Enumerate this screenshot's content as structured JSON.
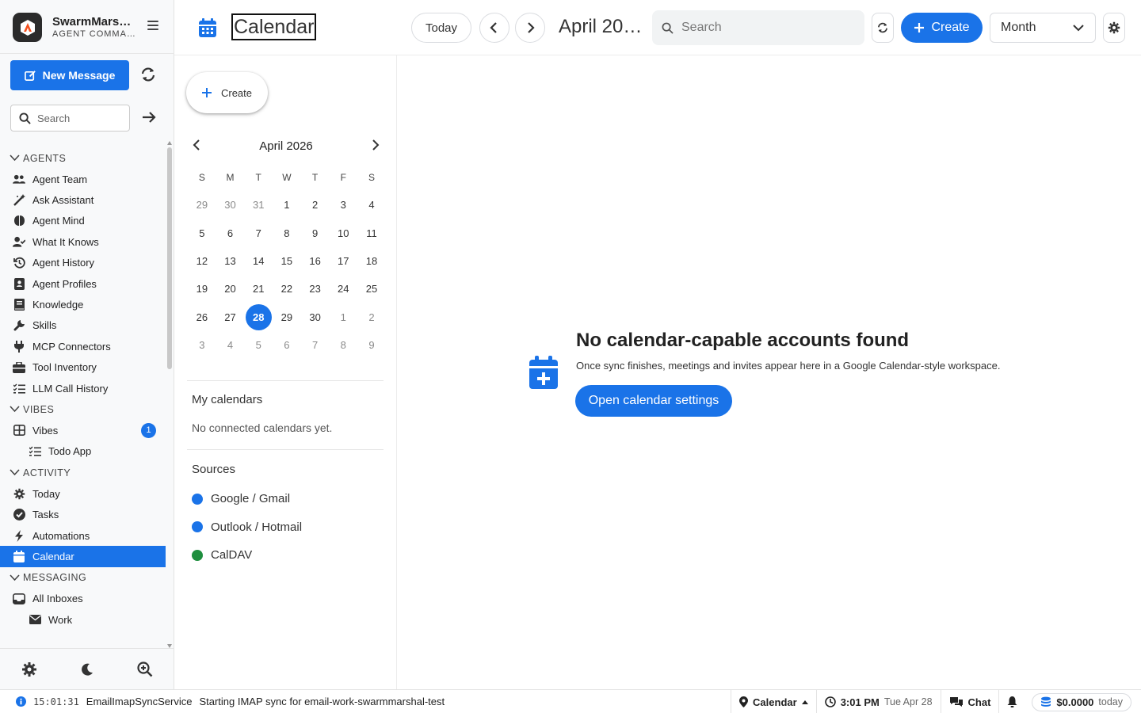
{
  "app": {
    "name": "SwarmMars…",
    "subtitle": "AGENT COMMA…"
  },
  "sidebar": {
    "new_message": "New Message",
    "search_placeholder": "Search",
    "sections": [
      {
        "label": "AGENTS",
        "items": [
          {
            "label": "Agent Team",
            "icon": "users-icon"
          },
          {
            "label": "Ask Assistant",
            "icon": "wand-icon"
          },
          {
            "label": "Agent Mind",
            "icon": "brain-icon"
          },
          {
            "label": "What It Knows",
            "icon": "user-check-icon"
          },
          {
            "label": "Agent History",
            "icon": "history-icon"
          },
          {
            "label": "Agent Profiles",
            "icon": "id-card-icon"
          },
          {
            "label": "Knowledge",
            "icon": "book-icon"
          },
          {
            "label": "Skills",
            "icon": "wrench-icon"
          },
          {
            "label": "MCP Connectors",
            "icon": "plug-icon"
          },
          {
            "label": "Tool Inventory",
            "icon": "toolbox-icon"
          },
          {
            "label": "LLM Call History",
            "icon": "list-check-icon"
          }
        ]
      },
      {
        "label": "VIBES",
        "items": [
          {
            "label": "Vibes",
            "icon": "grid-icon",
            "badge": "1"
          },
          {
            "label": "Todo App",
            "icon": "list-check-icon",
            "sub": true
          }
        ]
      },
      {
        "label": "ACTIVITY",
        "items": [
          {
            "label": "Today",
            "icon": "sun-gear-icon"
          },
          {
            "label": "Tasks",
            "icon": "check-circle-icon"
          },
          {
            "label": "Automations",
            "icon": "bolt-icon"
          },
          {
            "label": "Calendar",
            "icon": "calendar-icon",
            "active": true
          }
        ]
      },
      {
        "label": "MESSAGING",
        "items": [
          {
            "label": "All Inboxes",
            "icon": "inbox-icon"
          },
          {
            "label": "Work",
            "icon": "envelope-icon",
            "sub": true
          }
        ]
      }
    ]
  },
  "topbar": {
    "title": "Calendar",
    "today": "Today",
    "date_label": "April 20…",
    "search_placeholder": "Search",
    "create": "Create",
    "view": "Month"
  },
  "mini_calendar": {
    "create": "Create",
    "month_label": "April 2026",
    "weekdays": [
      "S",
      "M",
      "T",
      "W",
      "T",
      "F",
      "S"
    ],
    "weeks": [
      [
        {
          "d": "29",
          "dim": true
        },
        {
          "d": "30",
          "dim": true
        },
        {
          "d": "31",
          "dim": true
        },
        {
          "d": "1"
        },
        {
          "d": "2"
        },
        {
          "d": "3"
        },
        {
          "d": "4"
        }
      ],
      [
        {
          "d": "5"
        },
        {
          "d": "6"
        },
        {
          "d": "7"
        },
        {
          "d": "8"
        },
        {
          "d": "9"
        },
        {
          "d": "10"
        },
        {
          "d": "11"
        }
      ],
      [
        {
          "d": "12"
        },
        {
          "d": "13"
        },
        {
          "d": "14"
        },
        {
          "d": "15"
        },
        {
          "d": "16"
        },
        {
          "d": "17"
        },
        {
          "d": "18"
        }
      ],
      [
        {
          "d": "19"
        },
        {
          "d": "20"
        },
        {
          "d": "21"
        },
        {
          "d": "22"
        },
        {
          "d": "23"
        },
        {
          "d": "24"
        },
        {
          "d": "25"
        }
      ],
      [
        {
          "d": "26"
        },
        {
          "d": "27"
        },
        {
          "d": "28",
          "selected": true
        },
        {
          "d": "29"
        },
        {
          "d": "30"
        },
        {
          "d": "1",
          "dim": true
        },
        {
          "d": "2",
          "dim": true
        }
      ],
      [
        {
          "d": "3",
          "dim": true
        },
        {
          "d": "4",
          "dim": true
        },
        {
          "d": "5",
          "dim": true
        },
        {
          "d": "6",
          "dim": true
        },
        {
          "d": "7",
          "dim": true
        },
        {
          "d": "8",
          "dim": true
        },
        {
          "d": "9",
          "dim": true
        }
      ]
    ],
    "my_calendars_title": "My calendars",
    "my_calendars_empty": "No connected calendars yet.",
    "sources_title": "Sources",
    "sources": [
      {
        "label": "Google / Gmail",
        "color": "#1a73e8"
      },
      {
        "label": "Outlook / Hotmail",
        "color": "#1a73e8"
      },
      {
        "label": "CalDAV",
        "color": "#1e8e3e"
      }
    ]
  },
  "empty_state": {
    "title": "No calendar-capable accounts found",
    "description": "Once sync finishes, meetings and invites appear here in a Google Calendar-style workspace.",
    "button": "Open calendar settings"
  },
  "status_bar": {
    "time": "15:01:31",
    "service": "EmailImapSyncService",
    "message": "Starting IMAP sync for email-work-swarmmarshal-test",
    "location": "Calendar",
    "clock": "3:01 PM",
    "date": "Tue Apr 28",
    "chat": "Chat",
    "cost": "$0.0000",
    "cost_period": "today"
  },
  "colors": {
    "accent": "#1a73e8",
    "caldav": "#1e8e3e"
  }
}
